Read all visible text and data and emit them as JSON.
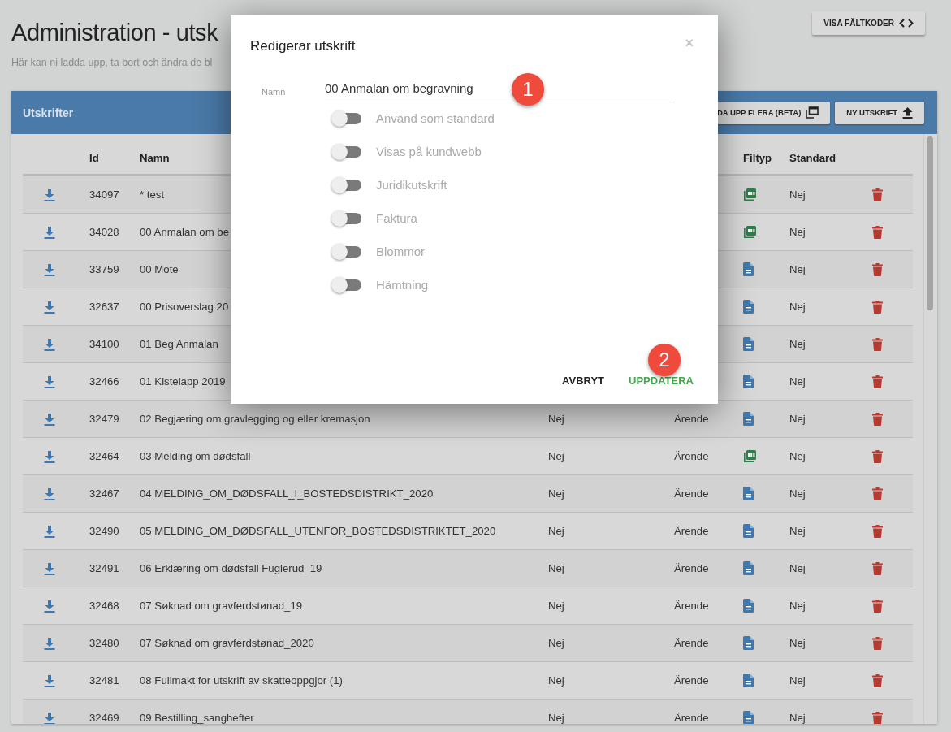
{
  "page": {
    "title": "Administration - utsk",
    "subtitle": "Här kan ni ladda upp, ta bort och ändra de bl",
    "field_codes_button": "VISA FÄLTKODER"
  },
  "panel": {
    "title": "Utskrifter",
    "buttons": [
      {
        "kind": "multi-upload",
        "label": "DA UPP FLERA (BETA)"
      },
      {
        "kind": "upload",
        "label": "NY UTSKRIFT"
      }
    ]
  },
  "table": {
    "columns": {
      "id": "Id",
      "name": "Namn",
      "filetype": "Filtyp",
      "standard": "Standard"
    },
    "rows": [
      {
        "id": "34097",
        "name": "* test",
        "kind": "pdf",
        "standard": "Nej"
      },
      {
        "id": "34028",
        "name": "00 Anmalan om be",
        "kind": "pdf",
        "standard": "Nej"
      },
      {
        "id": "33759",
        "name": "00 Mote",
        "kind": "document",
        "standard": "Nej"
      },
      {
        "id": "32637",
        "name": "00 Prisoverslag 20",
        "kind": "document",
        "standard": "Nej"
      },
      {
        "id": "34100",
        "name": "01 Beg Anmalan",
        "kind": "document",
        "standard": "Nej"
      },
      {
        "id": "32466",
        "name": "01 Kistelapp 2019",
        "kind": "document",
        "standard": "Nej"
      },
      {
        "id": "32479",
        "name": "02 Begjæring om gravlegging og eller kremasjon",
        "column_4": "Nej",
        "column_5": "Ärende",
        "kind": "document",
        "standard": "Nej"
      },
      {
        "id": "32464",
        "name": "03 Melding om dødsfall",
        "column_4": "Nej",
        "column_5": "Ärende",
        "kind": "pdf",
        "standard": "Nej"
      },
      {
        "id": "32467",
        "name": "04 MELDING_OM_DØDSFALL_I_BOSTEDSDISTRIKT_2020",
        "column_4": "Nej",
        "column_5": "Ärende",
        "kind": "document",
        "standard": "Nej"
      },
      {
        "id": "32490",
        "name": "05 MELDING_OM_DØDSFALL_UTENFOR_BOSTEDSDISTRIKTET_2020",
        "column_4": "Nej",
        "column_5": "Ärende",
        "kind": "document",
        "standard": "Nej"
      },
      {
        "id": "32491",
        "name": "06 Erklæring om dødsfall Fuglerud_19",
        "column_4": "Nej",
        "column_5": "Ärende",
        "kind": "document",
        "standard": "Nej"
      },
      {
        "id": "32468",
        "name": "07 Søknad om gravferdstønad_19",
        "column_4": "Nej",
        "column_5": "Ärende",
        "kind": "document",
        "standard": "Nej"
      },
      {
        "id": "32480",
        "name": "07 Søknad om gravferdstønad_2020",
        "column_4": "Nej",
        "column_5": "Ärende",
        "kind": "document",
        "standard": "Nej"
      },
      {
        "id": "32481",
        "name": "08 Fullmakt for utskrift av skatteoppgjor (1)",
        "column_4": "Nej",
        "column_5": "Ärende",
        "kind": "document",
        "standard": "Nej"
      },
      {
        "id": "32469",
        "name": "09 Bestilling_sanghefter",
        "column_4": "Nej",
        "column_5": "Ärende",
        "kind": "document",
        "standard": "Nej"
      }
    ]
  },
  "dialog": {
    "title": "Redigerar utskrift",
    "close": "×",
    "name_label": "Namn",
    "name_value": "00 Anmalan om begravning",
    "toggles": [
      {
        "label": "Använd som standard",
        "checked": false
      },
      {
        "label": "Visas på kundwebb",
        "checked": false
      },
      {
        "label": "Juridikutskrift",
        "checked": false
      },
      {
        "label": "Faktura",
        "checked": false
      },
      {
        "label": "Blommor",
        "checked": false
      },
      {
        "label": "Hämtning",
        "checked": false
      }
    ],
    "cancel_button": "AVBRYT",
    "update_button": "UPPDATERA",
    "markers": [
      {
        "label": "1"
      },
      {
        "label": "2"
      }
    ]
  }
}
